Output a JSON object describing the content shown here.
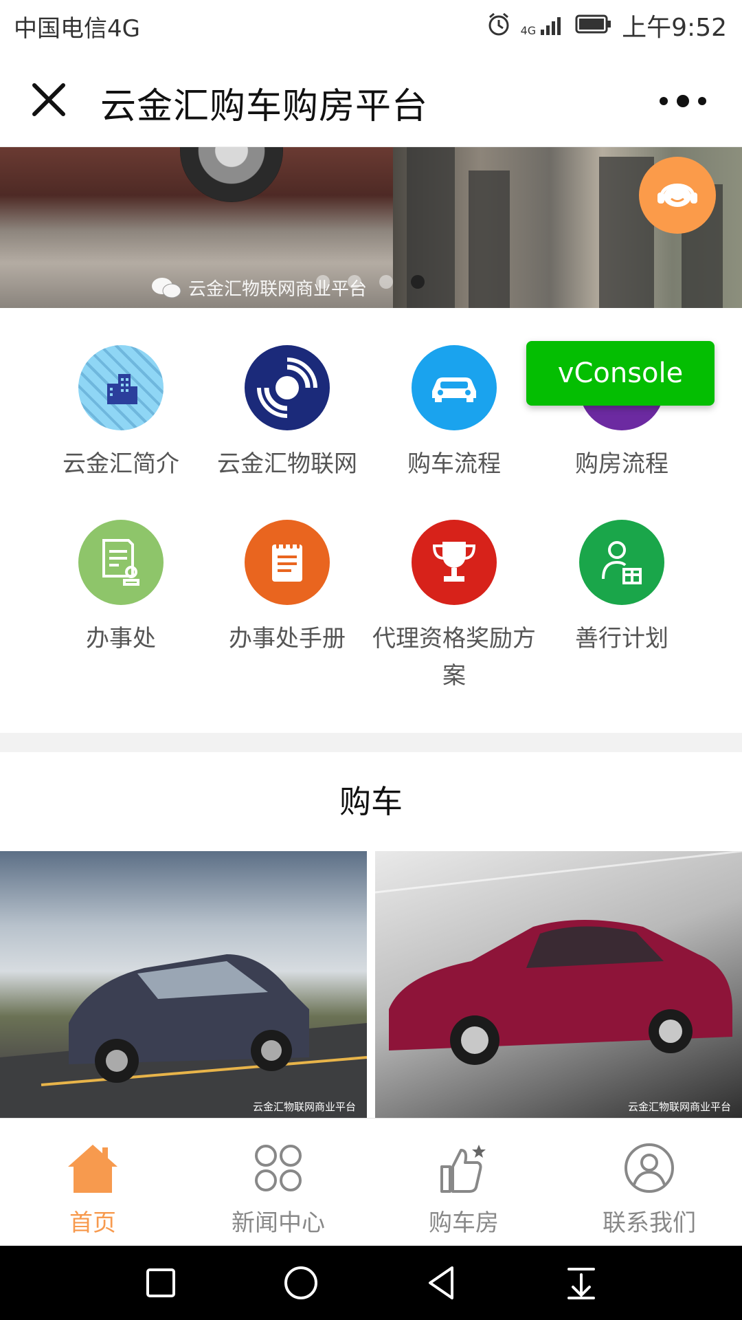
{
  "status_bar": {
    "carrier": "中国电信4G",
    "network_badge": "4G",
    "time": "上午9:52",
    "icons": [
      "alarm-icon",
      "signal-icon",
      "battery-icon"
    ]
  },
  "titlebar": {
    "title": "云金汇购车购房平台",
    "close_icon": "close-icon",
    "more_icon": "more-icon"
  },
  "banner": {
    "watermark": "云金汇物联网商业平台",
    "dot_count": 4,
    "active_dot": 4
  },
  "vconsole": {
    "label": "vConsole",
    "color": "#04be02"
  },
  "grid": {
    "items": [
      {
        "label": "云金汇简介",
        "icon": "building-icon",
        "color": "#82d0f3"
      },
      {
        "label": "云金汇物联网",
        "icon": "signal-waves-icon",
        "color": "#1b2a7a"
      },
      {
        "label": "购车流程",
        "icon": "car-icon",
        "color": "#1aa3ee"
      },
      {
        "label": "购房流程",
        "icon": "hand-icon",
        "color": "#6c2aa1"
      },
      {
        "label": "办事处",
        "icon": "document-stamp-icon",
        "color": "#8ec56a"
      },
      {
        "label": "办事处手册",
        "icon": "notebook-icon",
        "color": "#e9651f"
      },
      {
        "label": "代理资格奖励方案",
        "icon": "trophy-icon",
        "color": "#d7221a"
      },
      {
        "label": "善行计划",
        "icon": "user-gift-icon",
        "color": "#1aa64a"
      }
    ]
  },
  "section": {
    "title": "购车"
  },
  "cars": [
    {
      "watermark": "云金汇物联网商业平台",
      "icon": "suv-photo"
    },
    {
      "watermark": "云金汇物联网商业平台",
      "icon": "sedan-photo"
    }
  ],
  "tabbar": {
    "active_color": "#f79a4e",
    "items": [
      {
        "label": "首页",
        "icon": "home-icon"
      },
      {
        "label": "新闻中心",
        "icon": "grid-icon"
      },
      {
        "label": "购车房",
        "icon": "thumbs-up-icon"
      },
      {
        "label": "联系我们",
        "icon": "user-circle-icon"
      }
    ]
  }
}
